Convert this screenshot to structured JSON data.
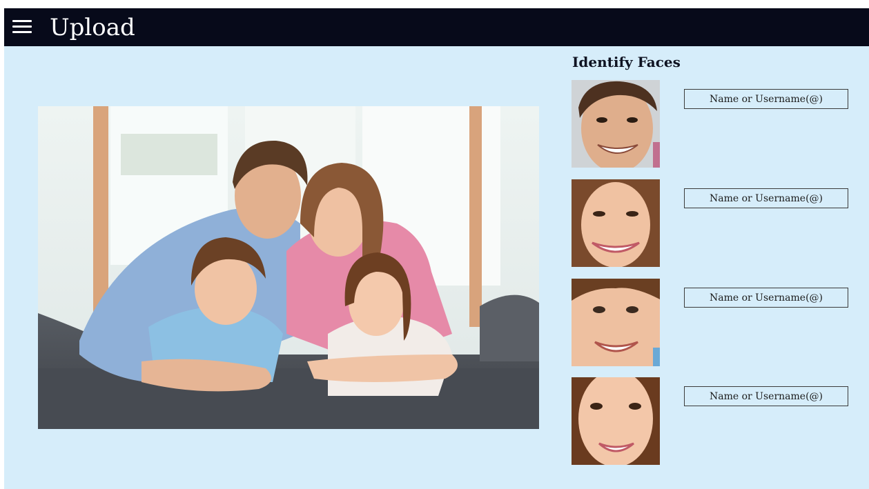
{
  "header": {
    "title": "Upload",
    "menu_icon": "hamburger-menu-icon",
    "background": "#070a1a"
  },
  "main": {
    "photo_description": "family-photo",
    "background": "#d6edfa"
  },
  "identify": {
    "title": "Identify Faces",
    "faces": [
      {
        "who": "man",
        "placeholder": "Name or Username(@)",
        "value": ""
      },
      {
        "who": "woman",
        "placeholder": "Name or Username(@)",
        "value": ""
      },
      {
        "who": "boy",
        "placeholder": "Name or Username(@)",
        "value": ""
      },
      {
        "who": "girl",
        "placeholder": "Name or Username(@)",
        "value": ""
      }
    ]
  }
}
